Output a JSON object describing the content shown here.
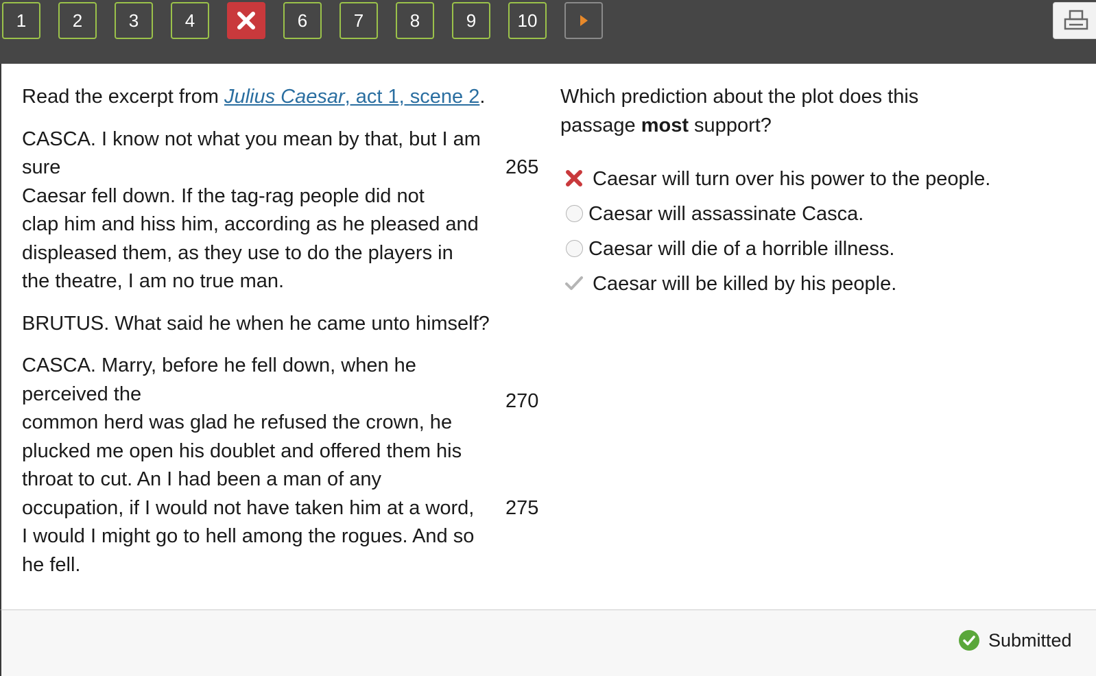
{
  "nav": {
    "questions": [
      "1",
      "2",
      "3",
      "4",
      "5",
      "6",
      "7",
      "8",
      "9",
      "10"
    ],
    "current_status": "incorrect",
    "next_icon": "play-arrow-icon",
    "print_icon": "print-icon",
    "colors": {
      "bar": "#464646",
      "border": "#9bc24a",
      "wrong": "#c9393c",
      "next_arrow": "#e8892a"
    }
  },
  "passage": {
    "intro_prefix": "Read the excerpt from ",
    "source_title": "Julius Caesar",
    "source_rest": ", act 1, scene 2",
    "intro_suffix": ".",
    "paragraphs": [
      {
        "lines": [
          {
            "text": "CASCA. I know not what you mean by that, but I am",
            "num": ""
          },
          {
            "text": "sure",
            "num": "265"
          },
          {
            "text": "Caesar fell down. If the tag-rag people did not",
            "num": ""
          },
          {
            "text": "clap him and hiss him, according as he pleased and",
            "num": ""
          },
          {
            "text": "displeased them, as they use to do the players in",
            "num": ""
          },
          {
            "text": "the theatre, I am no true man.",
            "num": ""
          }
        ]
      },
      {
        "lines": [
          {
            "text": "BRUTUS. What said he when he came unto himself?",
            "num": ""
          }
        ]
      },
      {
        "lines": [
          {
            "text": "CASCA. Marry, before he fell down, when he",
            "num": ""
          },
          {
            "text": "perceived the",
            "num": ""
          },
          {
            "text": "common herd was glad he refused the crown, he",
            "num": ""
          },
          {
            "text": "plucked me open his doublet and offered them his",
            "num": ""
          },
          {
            "text": "throat to cut. An I had been a man of any",
            "num": ""
          },
          {
            "text": "occupation, if I would not have taken him at a word,",
            "num": "275"
          },
          {
            "text": "I would I might go to hell among the rogues. And so",
            "num": ""
          },
          {
            "text": "he fell.",
            "num": ""
          }
        ]
      }
    ],
    "floating_num": "270"
  },
  "question": {
    "text_before": "Which prediction about the plot does this passage ",
    "text_bold": "most",
    "text_after": " support?",
    "answers": [
      {
        "text": "Caesar will turn over his power to the people.",
        "state": "incorrect",
        "icon": "x-mark-icon"
      },
      {
        "text": "Caesar will assassinate Casca.",
        "state": "unselected",
        "icon": "radio-icon"
      },
      {
        "text": "Caesar will die of a horrible illness.",
        "state": "unselected",
        "icon": "radio-icon"
      },
      {
        "text": "Caesar will be killed by his people.",
        "state": "correct",
        "icon": "checkmark-icon"
      }
    ]
  },
  "footer": {
    "status_text": "Submitted",
    "status_icon": "check-circle-icon",
    "status_color": "#5aa73a"
  }
}
